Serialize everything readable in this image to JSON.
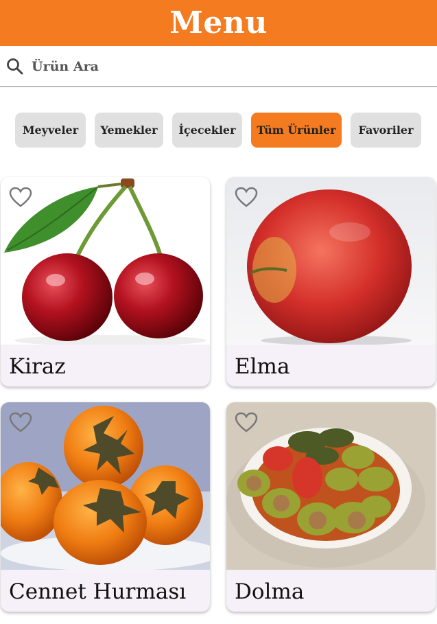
{
  "header": {
    "title": "Menu"
  },
  "search": {
    "placeholder": "Ürün Ara",
    "icon": "search-icon"
  },
  "categories": [
    {
      "label": "Meyveler",
      "active": false
    },
    {
      "label": "Yemekler",
      "active": false
    },
    {
      "label": "İçecekler",
      "active": false
    },
    {
      "label": "Tüm Ürünler",
      "active": true
    },
    {
      "label": "Favoriler",
      "active": false
    }
  ],
  "products": [
    {
      "name": "Kiraz",
      "favorite": false,
      "image": "cherries"
    },
    {
      "name": "Elma",
      "favorite": false,
      "image": "red-apple"
    },
    {
      "name": "Cennet Hurması",
      "favorite": false,
      "image": "persimmons"
    },
    {
      "name": "Dolma",
      "favorite": false,
      "image": "stuffed-vegetables"
    }
  ],
  "colors": {
    "accent": "#f47b20",
    "chip_bg": "#e0e0e0",
    "card_bg": "#f6f1f8"
  }
}
